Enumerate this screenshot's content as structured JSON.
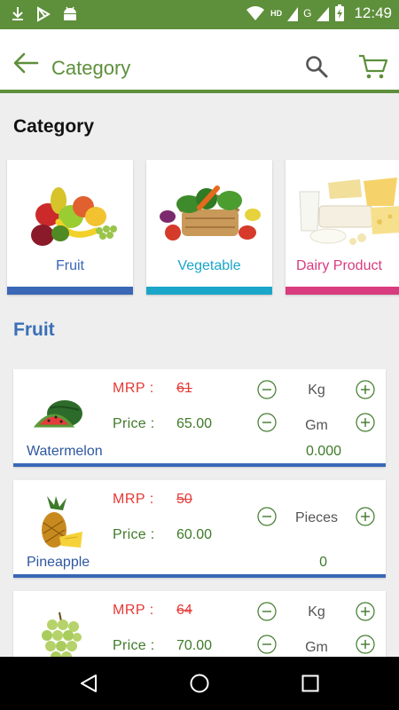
{
  "status_bar": {
    "time": "12:49",
    "network_hd": "HD",
    "network_g": "G"
  },
  "app_bar": {
    "title": "Category"
  },
  "category_section": {
    "title": "Category"
  },
  "categories": [
    {
      "label": "Fruit",
      "color": "#3a67b6"
    },
    {
      "label": "Vegetable",
      "color": "#1aa6c9"
    },
    {
      "label": "Dairy Product",
      "color": "#d93b7f"
    }
  ],
  "list_section": {
    "title": "Fruit"
  },
  "products": [
    {
      "name": "Watermelon",
      "mrp_label": "MRP :",
      "mrp": "61",
      "price_label": "Price :",
      "price": "65.00",
      "unit_top": "Kg",
      "unit_bottom": "Gm",
      "qty": "0.000"
    },
    {
      "name": "Pineapple",
      "mrp_label": "MRP :",
      "mrp": "50",
      "price_label": "Price :",
      "price": "60.00",
      "unit": "Pieces",
      "qty": "0"
    },
    {
      "name": "",
      "mrp_label": "MRP :",
      "mrp": "64",
      "price_label": "Price :",
      "price": "70.00",
      "unit_top": "Kg",
      "unit_bottom": "Gm"
    }
  ],
  "colors": {
    "primary": "#5e8f3b",
    "accent_blue": "#3a67b6",
    "mrp_red": "#e53935"
  }
}
